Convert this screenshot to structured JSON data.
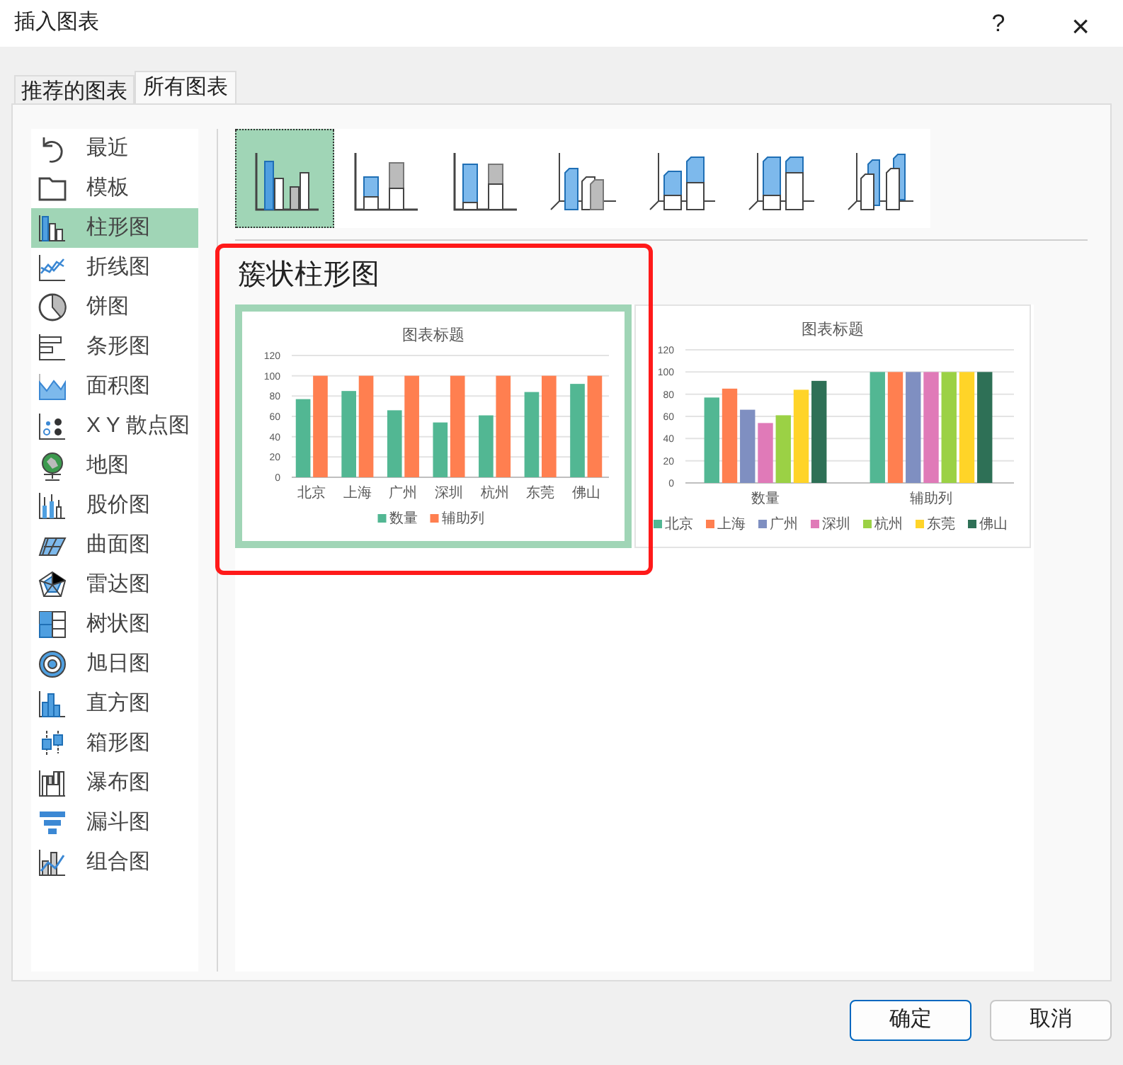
{
  "window": {
    "title": "插入图表",
    "help_button": "?",
    "close_button": "×"
  },
  "tabs": [
    {
      "label": "推荐的图表",
      "selected": false
    },
    {
      "label": "所有图表",
      "selected": true
    }
  ],
  "sidebar": {
    "items": [
      {
        "label": "最近",
        "selected": false
      },
      {
        "label": "模板",
        "selected": false
      },
      {
        "label": "柱形图",
        "selected": true
      },
      {
        "label": "折线图",
        "selected": false
      },
      {
        "label": "饼图",
        "selected": false
      },
      {
        "label": "条形图",
        "selected": false
      },
      {
        "label": "面积图",
        "selected": false
      },
      {
        "label": "X Y 散点图",
        "selected": false
      },
      {
        "label": "地图",
        "selected": false
      },
      {
        "label": "股价图",
        "selected": false
      },
      {
        "label": "曲面图",
        "selected": false
      },
      {
        "label": "雷达图",
        "selected": false
      },
      {
        "label": "树状图",
        "selected": false
      },
      {
        "label": "旭日图",
        "selected": false
      },
      {
        "label": "直方图",
        "selected": false
      },
      {
        "label": "箱形图",
        "selected": false
      },
      {
        "label": "瀑布图",
        "selected": false
      },
      {
        "label": "漏斗图",
        "selected": false
      },
      {
        "label": "组合图",
        "selected": false
      }
    ]
  },
  "subtypes": [
    {
      "selected": true
    },
    {
      "selected": false
    },
    {
      "selected": false
    },
    {
      "selected": false
    },
    {
      "selected": false
    },
    {
      "selected": false
    },
    {
      "selected": false
    }
  ],
  "chart_type_title": "簇状柱形图",
  "previews": [
    {
      "selected": true,
      "chart_data": {
        "type": "bar",
        "title": "图表标题",
        "categories": [
          "北京",
          "上海",
          "广州",
          "深圳",
          "杭州",
          "东莞",
          "佛山"
        ],
        "grid": true,
        "legend": "bottom",
        "ylim": [
          0,
          120
        ],
        "yticks": [
          0,
          20,
          40,
          60,
          80,
          100,
          120
        ],
        "series": [
          {
            "name": "数量",
            "color": "#52b793",
            "values": [
              77,
              85,
              66,
              54,
              61,
              84,
              92
            ]
          },
          {
            "name": "辅助列",
            "color": "#ff7f50",
            "values": [
              100,
              100,
              100,
              100,
              100,
              100,
              100
            ]
          }
        ]
      }
    },
    {
      "selected": false,
      "chart_data": {
        "type": "bar",
        "title": "图表标题",
        "categories": [
          "数量",
          "辅助列"
        ],
        "grid": true,
        "legend": "bottom",
        "ylim": [
          0,
          120
        ],
        "yticks": [
          0,
          20,
          40,
          60,
          80,
          100,
          120
        ],
        "series": [
          {
            "name": "北京",
            "color": "#52b793",
            "values": [
              77,
              100
            ]
          },
          {
            "name": "上海",
            "color": "#ff7f50",
            "values": [
              85,
              100
            ]
          },
          {
            "name": "广州",
            "color": "#7f8fc1",
            "values": [
              66,
              100
            ]
          },
          {
            "name": "深圳",
            "color": "#e07ab8",
            "values": [
              54,
              100
            ]
          },
          {
            "name": "杭州",
            "color": "#9bd145",
            "values": [
              61,
              100
            ]
          },
          {
            "name": "东莞",
            "color": "#ffd428",
            "values": [
              84,
              100
            ]
          },
          {
            "name": "佛山",
            "color": "#2e7056",
            "values": [
              92,
              100
            ]
          }
        ]
      }
    }
  ],
  "buttons": [
    {
      "label": "确定",
      "kind": "primary"
    },
    {
      "label": "取消",
      "kind": "secondary"
    }
  ]
}
